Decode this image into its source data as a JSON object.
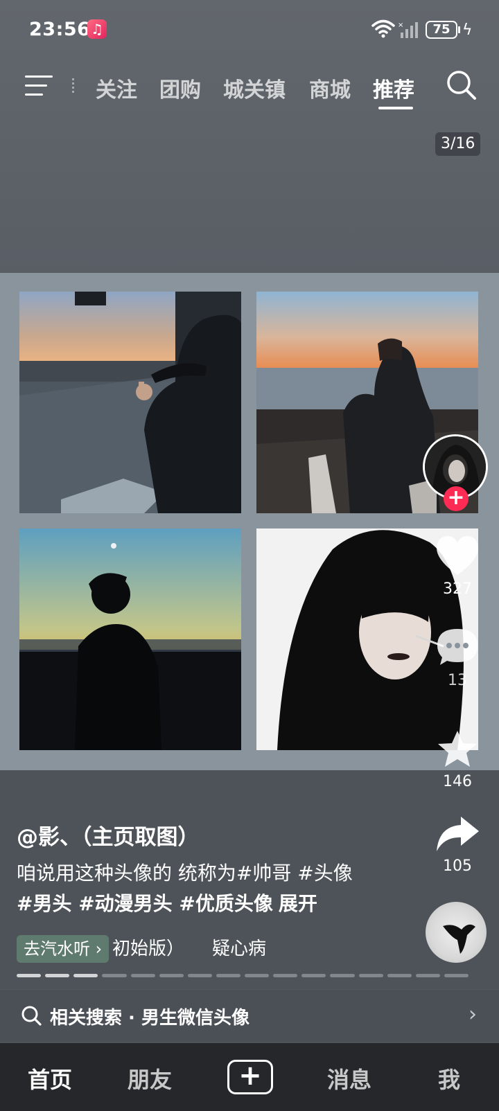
{
  "status_bar": {
    "time": "23:56",
    "battery_level": "75",
    "icons": [
      "music-app-icon",
      "wifi-icon",
      "signal-icon",
      "battery-icon",
      "charging-icon"
    ]
  },
  "top_nav": {
    "tabs": [
      {
        "label": "关注",
        "active": false
      },
      {
        "label": "团购",
        "active": false
      },
      {
        "label": "城关镇",
        "active": false
      },
      {
        "label": "商城",
        "active": false
      },
      {
        "label": "推荐",
        "active": true
      }
    ]
  },
  "image_counter": "3/16",
  "actions": {
    "likes": "327",
    "comments": "13",
    "favorites": "146",
    "shares": "105"
  },
  "caption": {
    "author": "@影、（主页取图）",
    "line1": "咱说用这种头像的 统称为#帅哥 #头像",
    "line2": "#男头 #动漫男头 #优质头像",
    "expand": "展开"
  },
  "music": {
    "chip": "去汽水听",
    "song_part1": "初始版）",
    "song_part2": "疑心病"
  },
  "progress": {
    "total": 16,
    "done": 3
  },
  "related_search": {
    "label": "相关搜索 · 男生微信头像"
  },
  "bottom_nav": {
    "items": [
      "首页",
      "朋友",
      "消息",
      "我"
    ]
  },
  "colors": {
    "accent": "#fe2c55",
    "music_chip": "#5f7a6e"
  }
}
